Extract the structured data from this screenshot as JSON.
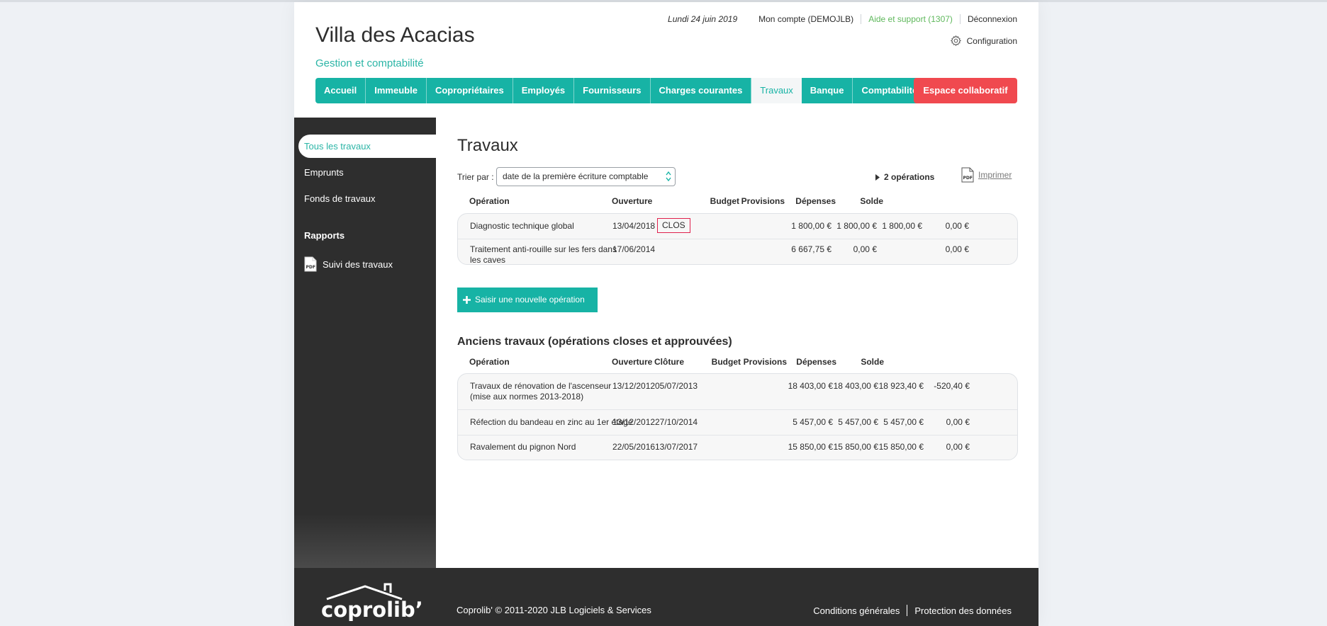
{
  "header": {
    "site_title": "Villa des Acacias",
    "site_subtitle": "Gestion et comptabilité",
    "date": "Lundi 24 juin 2019",
    "account": "Mon compte (DEMOJLB)",
    "support": "Aide et support (1307)",
    "logout": "Déconnexion",
    "config": "Configuration"
  },
  "nav": {
    "items": [
      "Accueil",
      "Immeuble",
      "Copropriétaires",
      "Employés",
      "Fournisseurs",
      "Charges courantes",
      "Travaux",
      "Banque",
      "Comptabilité"
    ],
    "active": "Travaux",
    "collab": "Espace collaboratif"
  },
  "sidebar": {
    "items": [
      "Tous les travaux",
      "Emprunts",
      "Fonds de travaux"
    ],
    "reports_heading": "Rapports",
    "report_item": "Suivi des travaux"
  },
  "main": {
    "title": "Travaux",
    "sort_label": "Trier par :",
    "sort_value": "date de la première écriture comptable",
    "ops_count": "2 opérations",
    "print": "Imprimer",
    "new_op": "Saisir une nouvelle opération",
    "current": {
      "headers": {
        "operation": "Opération",
        "ouverture": "Ouverture",
        "budget": "Budget",
        "provisions": "Provisions",
        "depenses": "Dépenses",
        "solde": "Solde"
      },
      "rows": [
        {
          "operation_line1": "Diagnostic technique global",
          "operation_line2": "",
          "ouverture": "13/04/2018",
          "status": "CLOS",
          "budget": "1 800,00 €",
          "provisions": "1 800,00 €",
          "depenses": "1 800,00 €",
          "solde": "0,00 €"
        },
        {
          "operation_line1": "Traitement anti-rouille sur les fers dans",
          "operation_line2": "les caves",
          "ouverture": "17/06/2014",
          "status": "",
          "budget": "6 667,75 €",
          "provisions": "0,00 €",
          "depenses": "",
          "solde": "0,00 €"
        }
      ]
    },
    "old_title": "Anciens travaux (opérations closes et approuvées)",
    "old": {
      "headers": {
        "operation": "Opération",
        "ouverture": "Ouverture",
        "cloture": "Clôture",
        "budget": "Budget",
        "provisions": "Provisions",
        "depenses": "Dépenses",
        "solde": "Solde"
      },
      "rows": [
        {
          "operation_line1": "Travaux de rénovation de l'ascenseur",
          "operation_line2": "(mise aux normes 2013-2018)",
          "ouverture": "13/12/2012",
          "cloture": "05/07/2013",
          "budget": "18 403,00 €",
          "provisions": "18 403,00 €",
          "depenses": "18 923,40 €",
          "solde": "-520,40 €"
        },
        {
          "operation_line1": "Réfection du bandeau en zinc au 1er étage",
          "operation_line2": "",
          "ouverture": "13/12/2012",
          "cloture": "27/10/2014",
          "budget": "5 457,00 €",
          "provisions": "5 457,00 €",
          "depenses": "5 457,00 €",
          "solde": "0,00 €"
        },
        {
          "operation_line1": "Ravalement du pignon Nord",
          "operation_line2": "",
          "ouverture": "22/05/2016",
          "cloture": "13/07/2017",
          "budget": "15 850,00 €",
          "provisions": "15 850,00 €",
          "depenses": "15 850,00 €",
          "solde": "0,00 €"
        }
      ]
    }
  },
  "footer": {
    "logo_text": "coprolib’",
    "copyright": "Coprolib' © 2011-2020 JLB Logiciels & Services",
    "terms": "Conditions générales",
    "privacy": "Protection des données"
  },
  "colors": {
    "teal": "#17b3a5",
    "red": "#f0494f",
    "dark": "#2e2e2e",
    "support_green": "#5fb85c"
  }
}
